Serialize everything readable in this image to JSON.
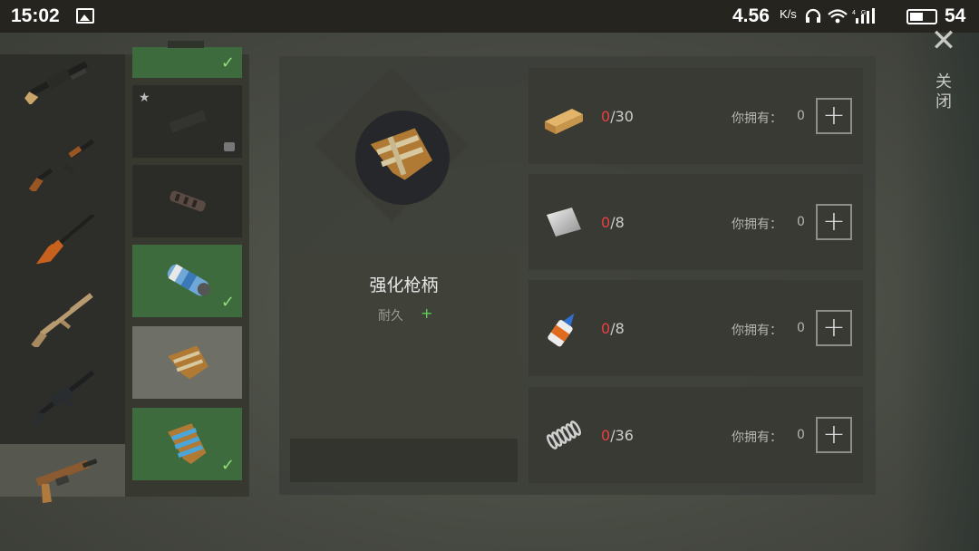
{
  "status_bar": {
    "time": "15:02",
    "speed": "4.56",
    "speed_unit": "K/s",
    "icons": "🎧 ◠ ▐",
    "battery_percent": 54
  },
  "weapons": [
    {
      "name": "shotgun-icon",
      "selected": false
    },
    {
      "name": "ak47-icon",
      "selected": false
    },
    {
      "name": "sniper-rifle-icon",
      "selected": false
    },
    {
      "name": "scar-rifle-icon",
      "selected": false
    },
    {
      "name": "m16-rifle-icon",
      "selected": false
    },
    {
      "name": "pistol-grip-gun-icon",
      "selected": true
    }
  ],
  "parts": [
    {
      "name": "part-scope-icon",
      "owned": true,
      "locked": false,
      "starred": false,
      "active": false
    },
    {
      "name": "part-gun-assembly-icon",
      "owned": false,
      "locked": true,
      "starred": true,
      "active": false
    },
    {
      "name": "part-muzzle-icon",
      "owned": false,
      "locked": false,
      "starred": false,
      "active": false
    },
    {
      "name": "part-suppressor-icon",
      "owned": true,
      "locked": false,
      "starred": false,
      "active": false
    },
    {
      "name": "part-reinforced-grip-icon",
      "owned": false,
      "locked": false,
      "starred": false,
      "active": true
    },
    {
      "name": "part-blue-grip-icon",
      "owned": true,
      "locked": false,
      "starred": false,
      "active": false
    }
  ],
  "selected_item": {
    "icon": "reinforced-grip-icon",
    "name": "强化枪柄",
    "stat_label": "耐久",
    "stat_plus": "+"
  },
  "materials": [
    {
      "icon": "wood-plank-icon",
      "have": "0",
      "need": "/30",
      "owned_label": "你拥有：",
      "owned_value": "0",
      "add": "+"
    },
    {
      "icon": "metal-sheet-icon",
      "have": "0",
      "need": "/8",
      "owned_label": "你拥有：",
      "owned_value": "0",
      "add": "+"
    },
    {
      "icon": "glue-bottle-icon",
      "have": "0",
      "need": "/8",
      "owned_label": "你拥有：",
      "owned_value": "0",
      "add": "+"
    },
    {
      "icon": "spring-icon",
      "have": "0",
      "need": "/36",
      "owned_label": "你拥有：",
      "owned_value": "0",
      "add": "+"
    }
  ],
  "close": {
    "icon": "✕",
    "label": "关闭"
  },
  "colors": {
    "owned_green": "#3e6b3d",
    "check_green": "#8fe07a",
    "count_red": "#e94040",
    "stat_green": "#5bcf57"
  }
}
